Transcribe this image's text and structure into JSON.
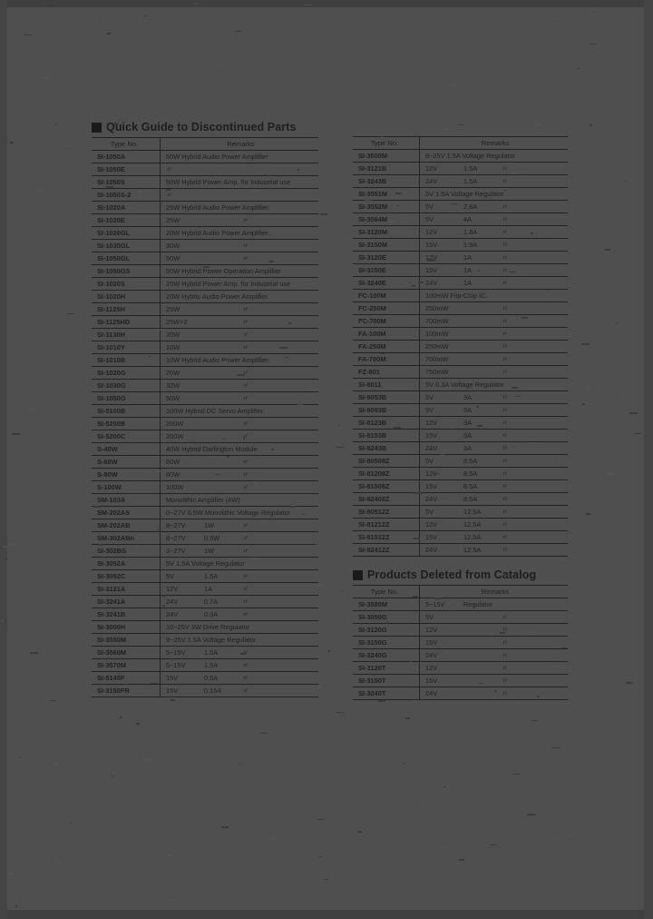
{
  "page": {
    "background_color": "#4f4f4f",
    "text_color": "#1f1f1f"
  },
  "sections": [
    {
      "id": "discontinued",
      "title": "Quick Guide to Discontinued Parts",
      "bullet": "black-square-bullet"
    },
    {
      "id": "deleted",
      "title": "Products Deleted from Catalog",
      "bullet": "black-square-bullet"
    }
  ],
  "columns": {
    "headers": {
      "type_no": "Type No.",
      "remarks": "Remarks"
    }
  },
  "left_table": {
    "header": {
      "type_no": "Type No.",
      "remarks": "Remarks"
    },
    "rows": [
      {
        "type": "SI-1050A",
        "remark": "50W Hybrid Audio Power Amplifier"
      },
      {
        "type": "SI-1050E",
        "remark": "〃",
        "ditto": true
      },
      {
        "type": "SI-1050S",
        "remark": "50W Hybrid Power Amp. for Industrial use"
      },
      {
        "type": "SI-1050S-2",
        "remark": "〃",
        "ditto": true
      },
      {
        "type": "SI-1020A",
        "remark": "25W Hybrid Audio Power Amplifier."
      },
      {
        "type": "SI-1020E",
        "v": "25W",
        "i": "",
        "t": "〃"
      },
      {
        "type": "SI-1020GL",
        "remark": "20W Hybrid Audio Power Amplifier."
      },
      {
        "type": "SI-1030GL",
        "v": "30W",
        "i": "",
        "t": "〃"
      },
      {
        "type": "SI-1050GL",
        "v": "50W",
        "i": "",
        "t": "〃"
      },
      {
        "type": "SI-1050GS",
        "remark": "50W Hybrid Power Operation Amplifier"
      },
      {
        "type": "SI-1020S",
        "remark": "25W Hybrid Power Amp. for Industrial use"
      },
      {
        "type": "SI-1020H",
        "remark": "20W Hybric Audio Power Amplifier."
      },
      {
        "type": "SI-1125H",
        "v": "25W",
        "i": "",
        "t": "〃"
      },
      {
        "type": "SI-1125HD",
        "v": "25W×2",
        "i": "",
        "t": "〃"
      },
      {
        "type": "SI-1130H",
        "v": "30W",
        "i": "",
        "t": "〃"
      },
      {
        "type": "SI-1010Y",
        "v": "10W",
        "i": "",
        "t": "〃"
      },
      {
        "type": "SI-1010B",
        "remark": "10W Hybrid Audio Power Amplifier."
      },
      {
        "type": "SI-1020G",
        "v": "20W",
        "i": "",
        "t": "〃"
      },
      {
        "type": "SI-1030G",
        "v": "32W",
        "i": "",
        "t": "〃"
      },
      {
        "type": "SI-1050G",
        "v": "50W",
        "i": "",
        "t": "〃"
      },
      {
        "type": "SI-5100B",
        "remark": "100W Hybrid DC Servo Amplifier."
      },
      {
        "type": "SI-5200B",
        "v": "200W",
        "i": "",
        "t": "〃"
      },
      {
        "type": "SI-5200C",
        "v": "200W",
        "i": "",
        "t": "〃"
      },
      {
        "type": "S-40W",
        "remark": "40W Hybrid Darlington Module"
      },
      {
        "type": "S-60W",
        "v": "60W",
        "i": "",
        "t": "〃"
      },
      {
        "type": "S-80W",
        "v": "80W",
        "i": "",
        "t": "〃"
      },
      {
        "type": "S-100W",
        "v": "100W",
        "i": "",
        "t": "〃"
      },
      {
        "type": "SM-103A",
        "remark": "Monolithic Amplifier  (4W)"
      },
      {
        "type": "SM-202AS",
        "remark": "0~27V  0.5W Monolithic Voltage Regulator"
      },
      {
        "type": "SM-202AB",
        "v": "8~27V",
        "i": "1W",
        "t": "〃"
      },
      {
        "type": "SM-302ABn",
        "v": "8~27V",
        "i": "0.5W",
        "t": "〃"
      },
      {
        "type": "SI-302BS",
        "v": "3~27V",
        "i": "1W",
        "t": "〃"
      },
      {
        "type": "SI-3052A",
        "remark": "5V 1.5A Voltage Regulator"
      },
      {
        "type": "SI-3052C",
        "v": "5V",
        "i": "1.5A",
        "t": "〃"
      },
      {
        "type": "SI-3121A",
        "v": "12V",
        "i": "1A",
        "t": "〃"
      },
      {
        "type": "SI-3241A",
        "v": "24V",
        "i": "0.7A",
        "t": "〃"
      },
      {
        "type": "SI-3241B",
        "v": "24V",
        "i": "0.3A",
        "t": "〃"
      },
      {
        "type": "SI-3000H",
        "remark": "10~25V  3W Drive Regulator"
      },
      {
        "type": "SI-3550M",
        "remark": "9~25V   1.5A Voltage Regulator"
      },
      {
        "type": "SI-3560M",
        "v": "5~15V",
        "i": "1.5A",
        "t": "〃"
      },
      {
        "type": "SI-3570M",
        "v": "5~15V",
        "i": "1.5A",
        "t": "〃"
      },
      {
        "type": "SI-5145F",
        "v": "15V",
        "i": "0.5A",
        "t": "〃"
      },
      {
        "type": "SI-3150FR",
        "v": "15V",
        "i": "0.15A",
        "t": "〃"
      }
    ]
  },
  "right_table": {
    "header": {
      "type_no": "Type No.",
      "remarks": "Remarks"
    },
    "rows": [
      {
        "type": "SI-3500M",
        "remark": "8~25V   1.5A Voltage Regulator"
      },
      {
        "type": "SI-3121B",
        "v": "12V",
        "i": "1.5A",
        "t": "〃"
      },
      {
        "type": "SI-3243B",
        "v": "24V",
        "i": "1.5A",
        "t": "〃"
      },
      {
        "type": "SI-3551M",
        "remark": "5V   1.5A Voltage Regulator"
      },
      {
        "type": "SI-3552M",
        "v": "5V",
        "i": "2.8A",
        "t": "〃"
      },
      {
        "type": "SI-3564M",
        "v": "5V",
        "i": "4A",
        "t": "〃"
      },
      {
        "type": "SI-3120M",
        "v": "12V",
        "i": "1.8A",
        "t": "〃"
      },
      {
        "type": "SI-3150M",
        "v": "15V",
        "i": "1.9A",
        "t": "〃"
      },
      {
        "type": "SI-3120E",
        "v": "12V",
        "i": "1A",
        "t": "〃"
      },
      {
        "type": "SI-3150E",
        "v": "15V",
        "i": "1A",
        "t": "〃"
      },
      {
        "type": "SI-3240E",
        "v": "24V",
        "i": "1A",
        "t": "〃"
      },
      {
        "type": "FC-100M",
        "remark": "100mW Flip-Chip IC."
      },
      {
        "type": "FC-250M",
        "v": "250mW",
        "i": "",
        "t": "〃"
      },
      {
        "type": "FC-700M",
        "v": "700mW",
        "i": "",
        "t": "〃"
      },
      {
        "type": "FA-100M",
        "v": "100mW",
        "i": "",
        "t": "〃"
      },
      {
        "type": "FA-250M",
        "v": "250mW",
        "i": "",
        "t": "〃"
      },
      {
        "type": "FA-700M",
        "v": "700mW",
        "i": "",
        "t": "〃"
      },
      {
        "type": "FZ-801",
        "v": "750mW",
        "i": "",
        "t": "〃"
      },
      {
        "type": "SI-8011",
        "remark": "5V   0.3A Voltage Regulator"
      },
      {
        "type": "SI-8053B",
        "v": "5V",
        "i": "3A",
        "t": "〃"
      },
      {
        "type": "SI-8093B",
        "v": "9V",
        "i": "3A",
        "t": "〃"
      },
      {
        "type": "SI-8123B",
        "v": "12V",
        "i": "3A",
        "t": "〃"
      },
      {
        "type": "SI-8153B",
        "v": "15V",
        "i": "3A",
        "t": "〃"
      },
      {
        "type": "SI-8243B",
        "v": "24V",
        "i": "3A",
        "t": "〃"
      },
      {
        "type": "SI-80508Z",
        "v": "5V",
        "i": "8.5A",
        "t": "〃"
      },
      {
        "type": "SI-81208Z",
        "v": "12V",
        "i": "8.5A",
        "t": "〃"
      },
      {
        "type": "SI-81508Z",
        "v": "15V",
        "i": "8.5A",
        "t": "〃"
      },
      {
        "type": "SI-82408Z",
        "v": "24V",
        "i": "8.5A",
        "t": "〃"
      },
      {
        "type": "SI-80512Z",
        "v": "5V",
        "i": "12.5A",
        "t": "〃"
      },
      {
        "type": "SI-81212Z",
        "v": "12V",
        "i": "12.5A",
        "t": "〃"
      },
      {
        "type": "SI-81512Z",
        "v": "15V",
        "i": "12.5A",
        "t": "〃"
      },
      {
        "type": "SI-82412Z",
        "v": "24V",
        "i": "12.5A",
        "t": "〃"
      }
    ]
  },
  "deleted_table": {
    "header": {
      "type_no": "Type No.",
      "remarks": "Remarks"
    },
    "rows": [
      {
        "type": "SI-3580M",
        "v": "5~15V",
        "i": "Regulator",
        "t": ""
      },
      {
        "type": "SI-3050G",
        "v": "5V",
        "i": "",
        "t": "〃"
      },
      {
        "type": "SI-3120G",
        "v": "12V",
        "i": "",
        "t": "〃"
      },
      {
        "type": "SI-3150G",
        "v": "15V",
        "i": "",
        "t": "〃"
      },
      {
        "type": "SI-3240G",
        "v": "24V",
        "i": "",
        "t": "〃"
      },
      {
        "type": "SI-3120T",
        "v": "12V",
        "i": "",
        "t": "〃"
      },
      {
        "type": "SI-3150T",
        "v": "15V",
        "i": "",
        "t": "〃"
      },
      {
        "type": "SI-3240T",
        "v": "24V",
        "i": "",
        "t": "〃"
      }
    ]
  }
}
